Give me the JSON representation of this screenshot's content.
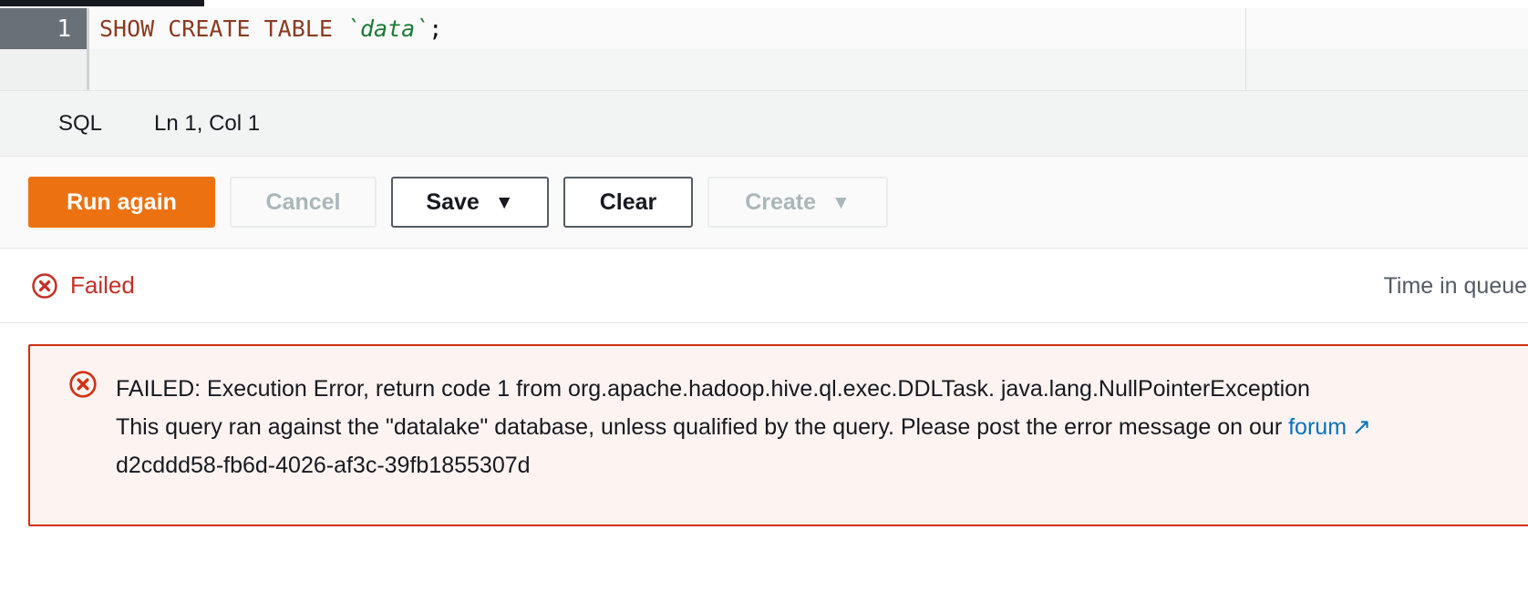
{
  "editor": {
    "line_number": "1",
    "code_tokens": [
      {
        "text": "SHOW CREATE TABLE ",
        "kind": "keyword"
      },
      {
        "text": "`data`",
        "kind": "identifier"
      },
      {
        "text": ";",
        "kind": "punctuation"
      }
    ],
    "code_plain": "SHOW CREATE TABLE `data`;",
    "code_keyword": "SHOW CREATE TABLE ",
    "code_identifier": "`data`",
    "code_punct": ";"
  },
  "statusbar": {
    "language": "SQL",
    "cursor_position": "Ln 1, Col 1"
  },
  "actions": {
    "run_label": "Run again",
    "cancel_label": "Cancel",
    "save_label": "Save",
    "save_caret": "▼",
    "clear_label": "Clear",
    "create_label": "Create",
    "create_caret": "▼"
  },
  "result": {
    "status_icon": "error-circle-icon",
    "status_label": "Failed",
    "time_in_queue_label": "Time in queue:"
  },
  "alert": {
    "icon": "error-circle-icon",
    "line1": "FAILED: Execution Error, return code 1 from org.apache.hadoop.hive.ql.exec.DDLTask. java.lang.NullPointerException",
    "line2_before_link": "This query ran against the \"datalake\" database, unless qualified by the query. Please post the error message on our ",
    "link_label": "forum",
    "external_icon": "↗",
    "line3": "d2cddd58-fb6d-4026-af3c-39fb1855307d"
  },
  "colors": {
    "primary_orange": "#ec7211",
    "error_red": "#d13212",
    "failed_text": "#c33025",
    "link_blue": "#0073bb",
    "alert_bg": "#fdf3f1",
    "gutter_bg": "#687078"
  }
}
